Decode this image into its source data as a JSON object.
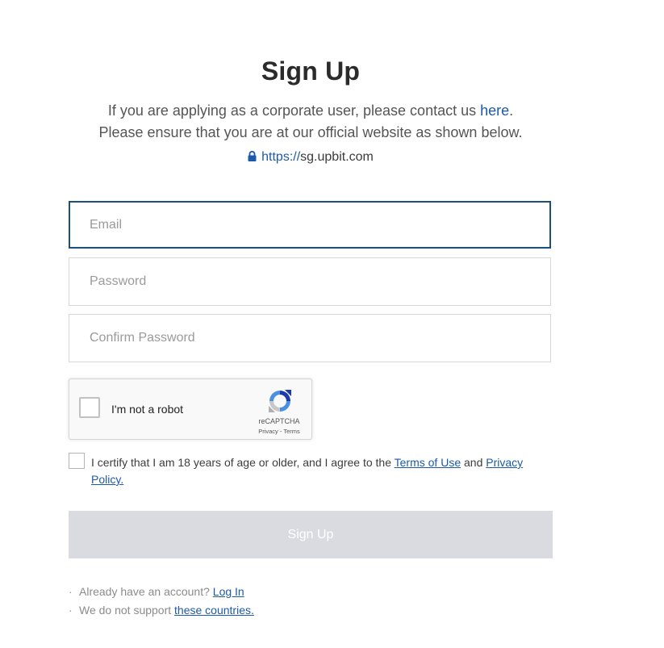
{
  "header": {
    "title": "Sign Up",
    "intro_line1_prefix": "If you are applying as a corporate user, please contact us ",
    "intro_line1_link": "here",
    "intro_line1_suffix": ".",
    "intro_line2": "Please ensure that you are at our official website as shown below.",
    "url_scheme": "https://",
    "url_host": "sg.upbit.com",
    "lock_icon": "lock-icon"
  },
  "form": {
    "email": {
      "placeholder": "Email",
      "value": ""
    },
    "password": {
      "placeholder": "Password",
      "value": ""
    },
    "confirm_password": {
      "placeholder": "Confirm Password",
      "value": ""
    }
  },
  "recaptcha": {
    "label": "I'm not a robot",
    "brand": "reCAPTCHA",
    "links": "Privacy - Terms",
    "checked": false
  },
  "certify": {
    "checked": false,
    "text_prefix": "I certify that I am 18 years of age or older, and I agree to the ",
    "terms_link": "Terms of Use",
    "text_middle": " and ",
    "privacy_link": "Privacy Policy."
  },
  "submit": {
    "label": "Sign Up",
    "enabled": false
  },
  "footer": {
    "bullet": "·",
    "login_prompt": "Already have an account? ",
    "login_link": "Log In",
    "countries_prompt": "We do not support ",
    "countries_link": "these countries."
  },
  "colors": {
    "link": "#1c5aa9",
    "focus_border": "#1d4f7c",
    "disabled_button": "#d9dbe0"
  }
}
